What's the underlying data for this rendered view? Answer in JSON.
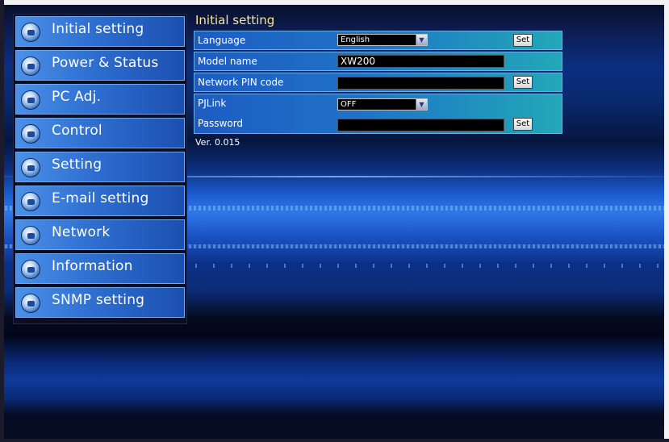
{
  "sidebar": {
    "items": [
      {
        "label": "Initial setting",
        "icon": "settings-icon"
      },
      {
        "label": "Power & Status",
        "icon": "power-icon"
      },
      {
        "label": "PC Adj.",
        "icon": "monitor-icon"
      },
      {
        "label": "Control",
        "icon": "control-icon"
      },
      {
        "label": "Setting",
        "icon": "tools-icon"
      },
      {
        "label": "E-mail setting",
        "icon": "mail-icon"
      },
      {
        "label": "Network",
        "icon": "network-icon"
      },
      {
        "label": "Information",
        "icon": "info-icon"
      },
      {
        "label": "SNMP setting",
        "icon": "snmp-icon"
      }
    ]
  },
  "main": {
    "title": "Initial setting",
    "rows": {
      "language": {
        "label": "Language",
        "value": "English"
      },
      "model_name": {
        "label": "Model name",
        "value": "XW200"
      },
      "network_pin": {
        "label": "Network PIN code",
        "value": ""
      },
      "pjlink": {
        "label": "PJLink",
        "value": "OFF"
      },
      "password": {
        "label": "Password",
        "value": ""
      }
    },
    "set_label": "Set",
    "version": "Ver. 0.015"
  },
  "colors": {
    "title_yellow": "#f6e89a",
    "nav_blue": "#2e6fd0",
    "row_teal": "#22a8b8"
  }
}
